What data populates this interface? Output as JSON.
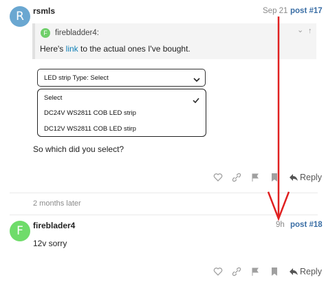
{
  "post1": {
    "avatar_letter": "R",
    "avatar_color": "#6aa7d1",
    "username": "rsmls",
    "date": "Sep 21",
    "post_number": "post #17",
    "quote": {
      "avatar_letter": "F",
      "author": "firebladder4:",
      "text_before": "Here's",
      "link_text": "link",
      "text_after": "to the actual ones I've bought."
    },
    "select": {
      "label": "LED strip Type: Select",
      "options": [
        "Select",
        "DC24V WS2811 COB LED strip",
        "DC12V WS2811 COB LED stirp"
      ],
      "selected_index": 0
    },
    "text": "So which did you select?",
    "reply_label": "Reply"
  },
  "time_gap": "2 months later",
  "post2": {
    "avatar_letter": "F",
    "avatar_color": "#6fdc6a",
    "username": "fireblader4",
    "date": "9h",
    "post_number": "post #18",
    "text": "12v sorry",
    "reply_label": "Reply"
  },
  "annotation_color": "#e02020"
}
